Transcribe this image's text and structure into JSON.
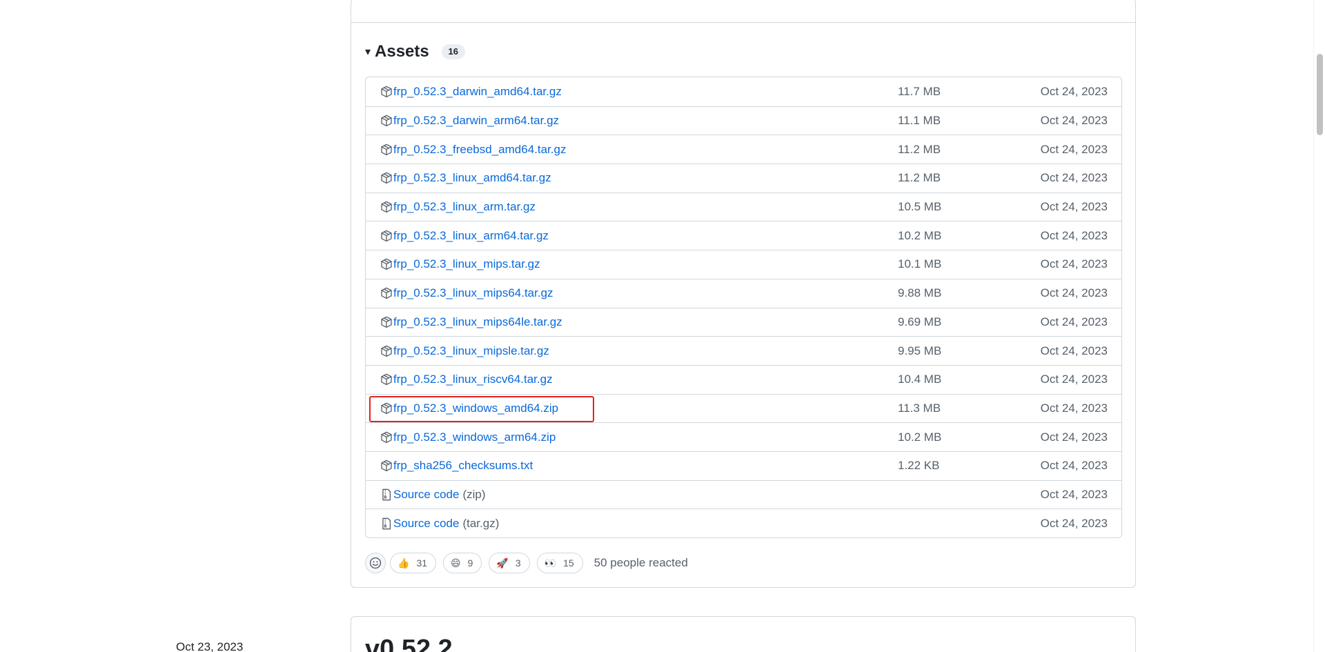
{
  "assets": {
    "title": "Assets",
    "toggle": "▾",
    "count": "16",
    "rows": [
      {
        "name": "frp_0.52.3_darwin_amd64.tar.gz",
        "suffix": "",
        "size": "11.7 MB",
        "date": "Oct 24, 2023",
        "icon": "package-icon"
      },
      {
        "name": "frp_0.52.3_darwin_arm64.tar.gz",
        "suffix": "",
        "size": "11.1 MB",
        "date": "Oct 24, 2023",
        "icon": "package-icon"
      },
      {
        "name": "frp_0.52.3_freebsd_amd64.tar.gz",
        "suffix": "",
        "size": "11.2 MB",
        "date": "Oct 24, 2023",
        "icon": "package-icon"
      },
      {
        "name": "frp_0.52.3_linux_amd64.tar.gz",
        "suffix": "",
        "size": "11.2 MB",
        "date": "Oct 24, 2023",
        "icon": "package-icon"
      },
      {
        "name": "frp_0.52.3_linux_arm.tar.gz",
        "suffix": "",
        "size": "10.5 MB",
        "date": "Oct 24, 2023",
        "icon": "package-icon"
      },
      {
        "name": "frp_0.52.3_linux_arm64.tar.gz",
        "suffix": "",
        "size": "10.2 MB",
        "date": "Oct 24, 2023",
        "icon": "package-icon"
      },
      {
        "name": "frp_0.52.3_linux_mips.tar.gz",
        "suffix": "",
        "size": "10.1 MB",
        "date": "Oct 24, 2023",
        "icon": "package-icon"
      },
      {
        "name": "frp_0.52.3_linux_mips64.tar.gz",
        "suffix": "",
        "size": "9.88 MB",
        "date": "Oct 24, 2023",
        "icon": "package-icon"
      },
      {
        "name": "frp_0.52.3_linux_mips64le.tar.gz",
        "suffix": "",
        "size": "9.69 MB",
        "date": "Oct 24, 2023",
        "icon": "package-icon"
      },
      {
        "name": "frp_0.52.3_linux_mipsle.tar.gz",
        "suffix": "",
        "size": "9.95 MB",
        "date": "Oct 24, 2023",
        "icon": "package-icon"
      },
      {
        "name": "frp_0.52.3_linux_riscv64.tar.gz",
        "suffix": "",
        "size": "10.4 MB",
        "date": "Oct 24, 2023",
        "icon": "package-icon"
      },
      {
        "name": "frp_0.52.3_windows_amd64.zip",
        "suffix": "",
        "size": "11.3 MB",
        "date": "Oct 24, 2023",
        "icon": "package-icon",
        "highlighted": true
      },
      {
        "name": "frp_0.52.3_windows_arm64.zip",
        "suffix": "",
        "size": "10.2 MB",
        "date": "Oct 24, 2023",
        "icon": "package-icon"
      },
      {
        "name": "frp_sha256_checksums.txt",
        "suffix": "",
        "size": "1.22 KB",
        "date": "Oct 24, 2023",
        "icon": "package-icon"
      },
      {
        "name": "Source code",
        "suffix": "(zip)",
        "size": "",
        "date": "Oct 24, 2023",
        "icon": "file-zip-icon"
      },
      {
        "name": "Source code",
        "suffix": "(tar.gz)",
        "size": "",
        "date": "Oct 24, 2023",
        "icon": "file-zip-icon"
      }
    ]
  },
  "reactions": {
    "items": [
      {
        "emoji": "👍",
        "count": "31",
        "icon": "thumbs-up-icon"
      },
      {
        "emoji": "😄",
        "count": "9",
        "icon": "laugh-icon"
      },
      {
        "emoji": "🚀",
        "count": "3",
        "icon": "rocket-icon"
      },
      {
        "emoji": "👀",
        "count": "15",
        "icon": "eyes-icon"
      }
    ],
    "summary": "50 people reacted"
  },
  "next_release": {
    "date": "Oct 23, 2023",
    "title": "v0.52.2"
  },
  "colors": {
    "link": "#0969da",
    "muted": "#57606a",
    "border": "#d0d7de",
    "highlight": "#e0221d"
  }
}
